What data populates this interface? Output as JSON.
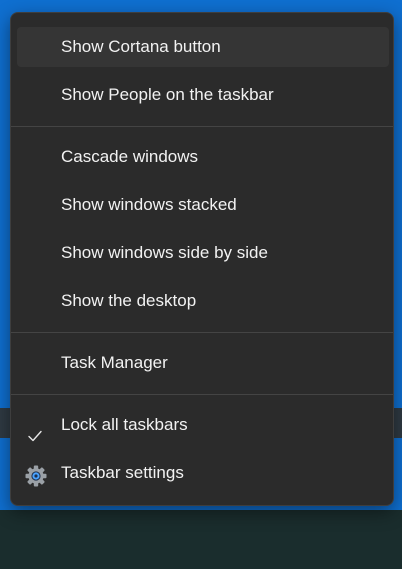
{
  "menu": {
    "items": [
      {
        "label": "Show Cortana button"
      },
      {
        "label": "Show People on the taskbar"
      },
      {
        "label": "Cascade windows"
      },
      {
        "label": "Show windows stacked"
      },
      {
        "label": "Show windows side by side"
      },
      {
        "label": "Show the desktop"
      },
      {
        "label": "Task Manager"
      },
      {
        "label": "Lock all taskbars",
        "checked": true
      },
      {
        "label": "Taskbar settings",
        "icon": "gear-icon"
      }
    ]
  },
  "colors": {
    "menu_background": "#2b2b2b",
    "hover_background": "#353535",
    "text": "#f2f2f2",
    "separator": "#444444",
    "accent": "#0f6fd0",
    "gear_dot": "#4aa3ff"
  }
}
